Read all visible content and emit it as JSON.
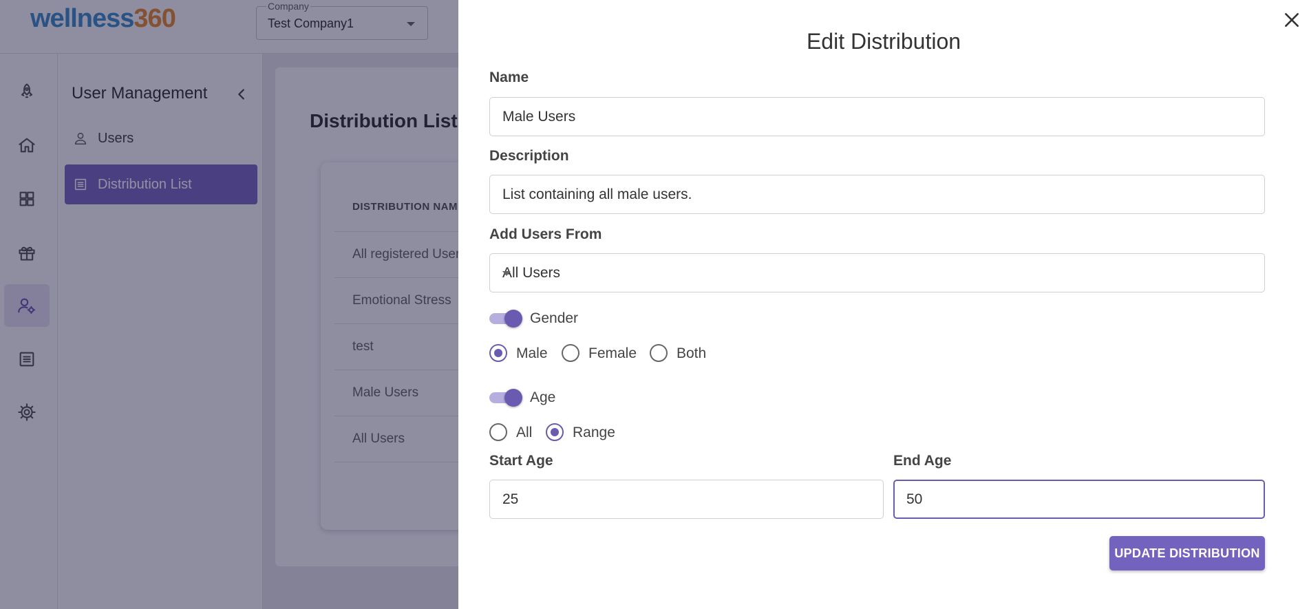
{
  "app": {
    "logo_main": "wellness",
    "logo_accent": "360"
  },
  "company": {
    "label": "Company",
    "value": "Test Company1"
  },
  "rail": {
    "icons": [
      "rocket-icon",
      "home-icon",
      "dashboard-icon",
      "gift-icon",
      "user-settings-icon",
      "list-icon",
      "gear-icon"
    ],
    "active": "user-settings-icon"
  },
  "subnav": {
    "title": "User Management",
    "items": [
      {
        "label": "Users",
        "icon": "user-icon",
        "active": false
      },
      {
        "label": "Distribution List",
        "icon": "list-icon",
        "active": true
      }
    ]
  },
  "page": {
    "heading": "Distribution Lists",
    "table": {
      "column": "DISTRIBUTION NAME",
      "rows": [
        "All registered Users",
        "Emotional Stress",
        "test",
        "Male Users",
        "All Users"
      ]
    }
  },
  "drawer": {
    "title": "Edit Distribution",
    "name_label": "Name",
    "name_value": "Male Users",
    "description_label": "Description",
    "description_value": "List containing all male users.",
    "add_users_label": "Add Users From",
    "add_users_value": "All Users",
    "gender_toggle_label": "Gender",
    "gender_enabled": true,
    "gender_options": [
      "Male",
      "Female",
      "Both"
    ],
    "gender_selected": "Male",
    "age_toggle_label": "Age",
    "age_enabled": true,
    "age_options": [
      "All",
      "Range"
    ],
    "age_selected": "Range",
    "start_age_label": "Start Age",
    "start_age_value": "25",
    "end_age_label": "End Age",
    "end_age_value": "50",
    "submit_label": "UPDATE DISTRIBUTION"
  },
  "colors": {
    "accent": "#6a5bb0",
    "button": "#7462bf",
    "overlay": "#0f0c32"
  }
}
